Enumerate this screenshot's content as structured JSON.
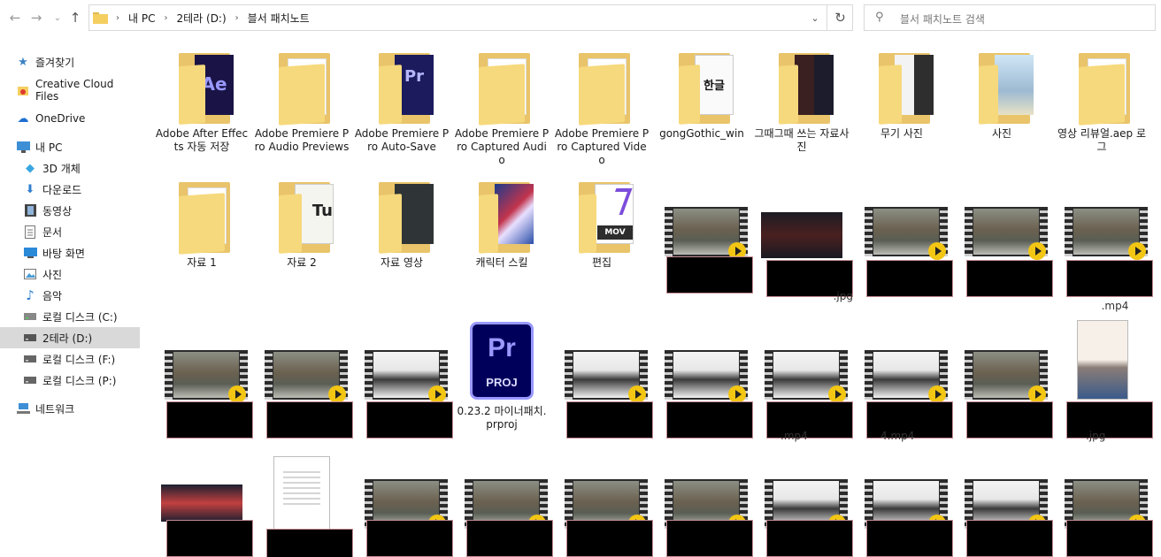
{
  "address": {
    "crumbs": [
      "내 PC",
      "2테라 (D:)",
      "블서 패치노트"
    ]
  },
  "search": {
    "placeholder": "블서 패치노트 검색"
  },
  "sidebar": {
    "items": [
      {
        "label": "즐겨찾기",
        "icon": "star-icon"
      },
      {
        "label": "Creative Cloud Files",
        "icon": "creative-cloud-icon"
      },
      {
        "label": "OneDrive",
        "icon": "onedrive-icon"
      },
      {
        "label": "내 PC",
        "icon": "pc-icon"
      },
      {
        "label": "3D 개체",
        "icon": "3d-objects-icon"
      },
      {
        "label": "다운로드",
        "icon": "download-icon"
      },
      {
        "label": "동영상",
        "icon": "video-icon"
      },
      {
        "label": "문서",
        "icon": "document-icon"
      },
      {
        "label": "바탕 화면",
        "icon": "desktop-icon"
      },
      {
        "label": "사진",
        "icon": "pictures-icon"
      },
      {
        "label": "음악",
        "icon": "music-icon"
      },
      {
        "label": "로컬 디스크 (C:)",
        "icon": "drive-icon"
      },
      {
        "label": "2테라 (D:)",
        "icon": "drive-icon"
      },
      {
        "label": "로컬 디스크 (F:)",
        "icon": "drive-icon"
      },
      {
        "label": "로컬 디스크 (P:)",
        "icon": "drive-icon"
      },
      {
        "label": "네트워크",
        "icon": "network-icon"
      }
    ]
  },
  "files": {
    "row1": [
      "Adobe After Effects 자동 저장",
      "Adobe Premiere Pro Audio Previews",
      "Adobe Premiere Pro Auto-Save",
      "Adobe Premiere Pro Captured Audio",
      "Adobe Premiere Pro Captured Video",
      "gongGothic_win",
      "그때그때 쓰는 자료사진",
      "무기 사진",
      "사진",
      "영상 리뷰얼.aep 로그"
    ],
    "row2_folders": [
      "자료 1",
      "자료 2",
      "자료 영상",
      "캐릭터 스킬",
      "편집"
    ],
    "row2_partial": [
      ".jpg",
      ".mp4"
    ],
    "row3_proj": "0.23.2 마이너패치.prproj",
    "row3_partial": [
      ".mp4",
      "4.mp4",
      ".jpg"
    ],
    "accent_video_play": "#f3c613",
    "folder_color": "#f6d97c"
  }
}
